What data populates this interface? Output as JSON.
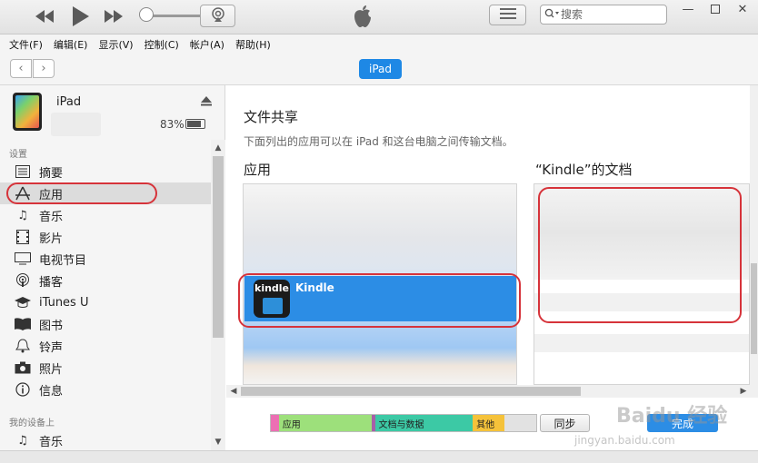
{
  "toolbar": {
    "search_placeholder": "搜索"
  },
  "menu": [
    "文件(F)",
    "编辑(E)",
    "显示(V)",
    "控制(C)",
    "帐户(A)",
    "帮助(H)"
  ],
  "nav": {
    "device_tab": "iPad"
  },
  "sidebar": {
    "device_name": "iPad",
    "battery_percent": "83%",
    "battery_level": 0.83,
    "section_settings": "设置",
    "items": [
      {
        "label": "摘要",
        "icon": "summary-icon"
      },
      {
        "label": "应用",
        "icon": "apps-icon",
        "selected": true
      },
      {
        "label": "音乐",
        "icon": "music-icon"
      },
      {
        "label": "影片",
        "icon": "movie-icon"
      },
      {
        "label": "电视节目",
        "icon": "tv-icon"
      },
      {
        "label": "播客",
        "icon": "podcast-icon"
      },
      {
        "label": "iTunes U",
        "icon": "itunes-u-icon"
      },
      {
        "label": "图书",
        "icon": "book-icon"
      },
      {
        "label": "铃声",
        "icon": "bell-icon"
      },
      {
        "label": "照片",
        "icon": "camera-icon"
      },
      {
        "label": "信息",
        "icon": "info-icon"
      }
    ],
    "section_my_device": "我的设备上",
    "my_device_items": [
      {
        "label": "音乐",
        "icon": "music-icon"
      }
    ]
  },
  "main": {
    "file_sharing_title": "文件共享",
    "file_sharing_subtitle": "下面列出的应用可以在 iPad 和这台电脑之间传输文档。",
    "apps_title": "应用",
    "docs_title": "“Kindle”的文档",
    "apps": [
      {
        "name": "Kindle",
        "selected": true
      }
    ],
    "kindle_icon_text": "kindle"
  },
  "capacity": [
    {
      "label": "",
      "color": "#ec6fb3",
      "fraction": 0.03
    },
    {
      "label": "应用",
      "color": "#9de07b",
      "fraction": 0.35
    },
    {
      "label": "",
      "color": "#a75fa8",
      "fraction": 0.01
    },
    {
      "label": "文档与数据",
      "color": "#3cc9a5",
      "fraction": 0.37
    },
    {
      "label": "其他",
      "color": "#f5c23a",
      "fraction": 0.12
    },
    {
      "label": "",
      "color": "#e2e2e2",
      "fraction": 0.12
    }
  ],
  "buttons": {
    "sync": "同步",
    "done": "完成"
  },
  "watermark": {
    "text": "Baidu 经验",
    "url": "jingyan.baidu.com"
  },
  "colors": {
    "accent": "#2c8de5",
    "highlight_oval": "#d6333a"
  }
}
